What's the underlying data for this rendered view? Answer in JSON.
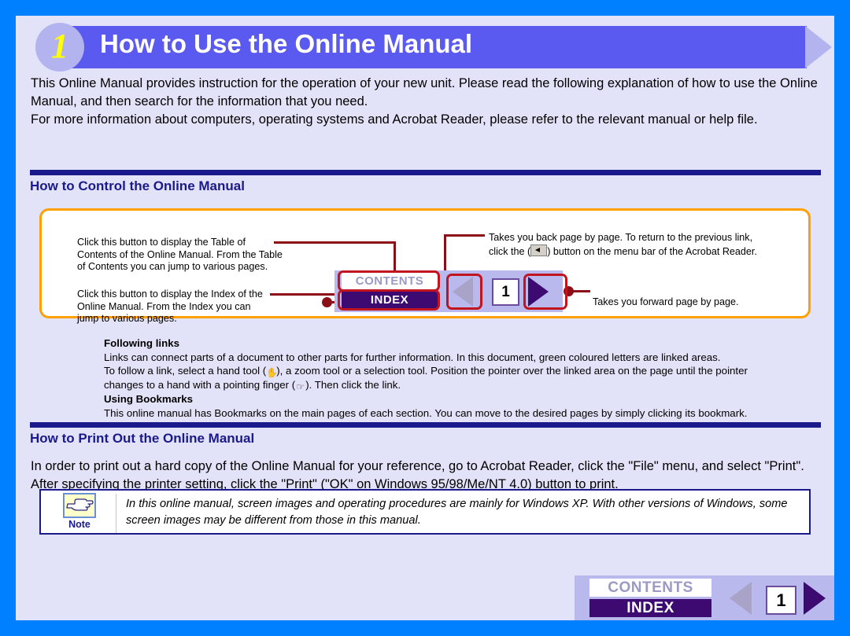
{
  "header": {
    "number": "1",
    "title": "How to Use the Online Manual"
  },
  "intro": {
    "para1": "This Online Manual provides instruction for the operation of your new unit. Please read the following explanation of how to use the Online Manual, and then search for the information that you need.",
    "para2": "For more information about computers, operating systems and Acrobat Reader, please refer to the relevant manual or help file."
  },
  "sections": {
    "control": {
      "title": "How to Control the Online Manual"
    },
    "print": {
      "title": "How to Print Out the Online Manual",
      "body": "In order to print out a hard copy of the Online Manual for your reference, go to Acrobat Reader, click the \"File\" menu, and select \"Print\". After specifying the printer setting, click the \"Print\" (\"OK\" on Windows 95/98/Me/NT 4.0) button to print."
    }
  },
  "diagram": {
    "callout_contents": "Click this button to display the Table of\nContents of the Online Manual. From the Table\nof Contents you can jump to various pages.",
    "callout_index": "Click this button to display the Index of the\nOnline Manual. From the Index you can\njump to various pages.",
    "callout_back_1": "Takes you back page by page. To return to the previous link,",
    "callout_back_2a": "click the (",
    "callout_back_2b": ") button on the menu bar of the Acrobat Reader.",
    "callout_forward": "Takes you forward page by page.",
    "nav": {
      "contents_label": "CONTENTS",
      "index_label": "INDEX",
      "page_number": "1",
      "prev_icon": "triangle-left-icon",
      "next_icon": "triangle-right-icon"
    }
  },
  "links_block": {
    "heading1": "Following links",
    "line1": "Links can connect parts of a document to other parts for further information. In this document, green coloured letters are linked areas.",
    "line2a": "To follow a link, select a hand tool (",
    "line2b": "), a zoom tool or a selection tool. Position the pointer over the linked area on the page until the pointer",
    "line3a": "changes to a hand with a pointing finger (",
    "line3b": "). Then click the link.",
    "heading2": "Using Bookmarks",
    "line4": "This online manual has Bookmarks on the main pages of each section. You can move to the desired pages by simply clicking its bookmark."
  },
  "note": {
    "label": "Note",
    "icon": "pointing-hand-icon",
    "text": "In this online manual, screen images and operating procedures are mainly for Windows XP. With other versions of Windows, some screen images may be different from those in this manual."
  },
  "bottom_nav": {
    "contents_label": "CONTENTS",
    "index_label": "INDEX",
    "page_number": "1",
    "prev_icon": "triangle-left-icon",
    "next_icon": "triangle-right-icon"
  },
  "colors": {
    "outer_border": "#0080ff",
    "page_bg": "#e2e2f8",
    "banner": "#5a5af0",
    "banner_accent": "#b3b3f0",
    "heading": "#1a1a8c",
    "diagram_border": "#ffa000",
    "connector": "#8c0f18",
    "highlight": "#c0141e",
    "index_bg": "#3d0a72",
    "number_yellow": "#ffff00"
  }
}
